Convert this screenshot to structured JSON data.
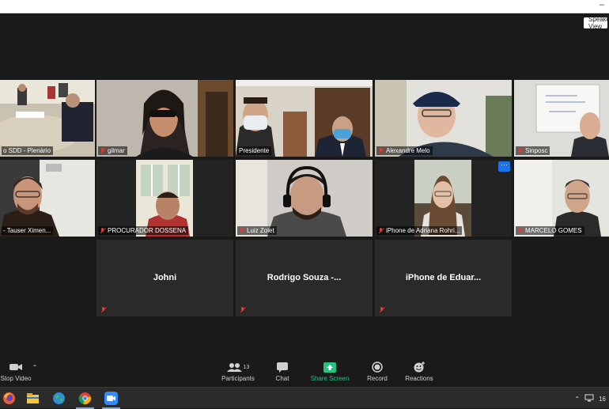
{
  "window": {
    "minimize_glyph": "–"
  },
  "speaker_view": {
    "label": "Speaker View",
    "icon": "grid-icon"
  },
  "participants_tiles": [
    {
      "name": "o SDD - Plenário",
      "muted": false,
      "active_speaker": true
    },
    {
      "name": "gilmar",
      "muted": true
    },
    {
      "name": "Presidente",
      "muted": false
    },
    {
      "name": "Alexandre Melo",
      "muted": true
    },
    {
      "name": "Sinposc",
      "muted": true
    },
    {
      "name": "- Tauser Ximen...",
      "muted": false
    },
    {
      "name": "PROCURADOR DOSSENA",
      "muted": true
    },
    {
      "name": "Luiz Zolet",
      "muted": true
    },
    {
      "name": "iPhone de Adriana Rohri...",
      "muted": true,
      "more_menu": "···"
    },
    {
      "name": "MARCELO GOMES",
      "muted": true
    }
  ],
  "name_only_tiles": [
    {
      "name": "Johni"
    },
    {
      "name": "Rodrigo Souza -..."
    },
    {
      "name": "iPhone de Eduar..."
    }
  ],
  "toolbar": {
    "stop_video": "Stop Video",
    "participants": "Participants",
    "participants_count": "13",
    "chat": "Chat",
    "share_screen": "Share Screen",
    "record": "Record",
    "reactions": "Reactions",
    "share_color": "#26c281"
  },
  "taskbar": {
    "apps": [
      "firefox-icon",
      "file-explorer-icon",
      "globe-icon",
      "chrome-icon",
      "zoom-icon"
    ],
    "clock_partial": "16"
  }
}
